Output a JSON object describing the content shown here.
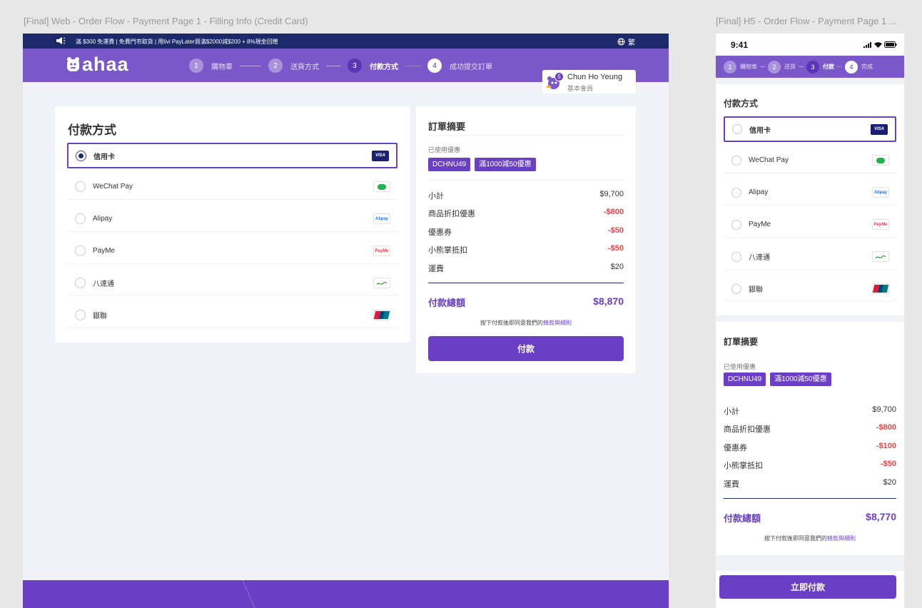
{
  "frames": {
    "web_title": "[Final] Web - Order Flow - Payment Page 1 - Filling Info (Credit Card)",
    "h5_title": "[Final] H5 - Order Flow - Payment Page 1 ..."
  },
  "web": {
    "promo_text": "滿 $300 免運費 | 免費門市取貨 | 用livi PayLater買滿$2000減$200 + 8%現金回贈",
    "language": "繁",
    "logo_text": "ahaa",
    "steps": [
      {
        "num": "1",
        "label": "購物車"
      },
      {
        "num": "2",
        "label": "送貨方式"
      },
      {
        "num": "3",
        "label": "付款方式"
      },
      {
        "num": "4",
        "label": "成功提交訂單"
      }
    ],
    "user": {
      "badge": "5",
      "name": "Chun Ho Yeung",
      "tier": "基本會員"
    },
    "payment": {
      "title": "付款方式",
      "options": [
        {
          "label": "信用卡",
          "icon": "visa-icon",
          "icon_text": "VISA",
          "selected": true
        },
        {
          "label": "WeChat Pay",
          "icon": "wechat-pay-icon",
          "selected": false
        },
        {
          "label": "Alipay",
          "icon": "alipay-icon",
          "icon_text": "Alipay",
          "selected": false
        },
        {
          "label": "PayMe",
          "icon": "payme-icon",
          "icon_text": "PayMe",
          "selected": false
        },
        {
          "label": "八達通",
          "icon": "octopus-icon",
          "selected": false
        },
        {
          "label": "銀聯",
          "icon": "unionpay-icon",
          "selected": false
        }
      ]
    },
    "summary": {
      "title": "訂單摘要",
      "used_label": "已使用優惠",
      "coupons": [
        "DCHNU49",
        "滿1000減50優惠"
      ],
      "rows": [
        {
          "label": "小計",
          "value": "$9,700",
          "negative": false
        },
        {
          "label": "商品折扣優惠",
          "value": "-$800",
          "negative": true
        },
        {
          "label": "優惠券",
          "value": "-$50",
          "negative": true
        },
        {
          "label": "小熊掌抵扣",
          "value": "-$50",
          "negative": true
        },
        {
          "label": "運費",
          "value": "$20",
          "negative": false
        }
      ],
      "total_label": "付款總額",
      "total_value": "$8,870",
      "terms_prefix": "按下付款後即同意我們的",
      "terms_link": "條款與細則",
      "pay_button": "付款"
    }
  },
  "h5": {
    "time": "9:41",
    "steps": [
      {
        "num": "1",
        "label": "購物車"
      },
      {
        "num": "2",
        "label": "送貨"
      },
      {
        "num": "3",
        "label": "付款"
      },
      {
        "num": "4",
        "label": "完成"
      }
    ],
    "payment": {
      "title": "付款方式",
      "options": [
        {
          "label": "信用卡",
          "icon": "visa-icon",
          "icon_text": "VISA",
          "selected": true
        },
        {
          "label": "WeChat Pay",
          "icon": "wechat-pay-icon",
          "selected": false
        },
        {
          "label": "Alipay",
          "icon": "alipay-icon",
          "icon_text": "Alipay",
          "selected": false
        },
        {
          "label": "PayMe",
          "icon": "payme-icon",
          "icon_text": "PayMe",
          "selected": false
        },
        {
          "label": "八達通",
          "icon": "octopus-icon",
          "selected": false
        },
        {
          "label": "銀聯",
          "icon": "unionpay-icon",
          "selected": false
        }
      ]
    },
    "summary": {
      "title": "訂單摘要",
      "used_label": "已使用優惠",
      "coupons": [
        "DCHNU49",
        "滿1000減50優惠"
      ],
      "rows": [
        {
          "label": "小計",
          "value": "$9,700",
          "negative": false
        },
        {
          "label": "商品折扣優惠",
          "value": "-$800",
          "negative": true
        },
        {
          "label": "優惠券",
          "value": "-$100",
          "negative": true
        },
        {
          "label": "小熊掌抵扣",
          "value": "-$50",
          "negative": true
        },
        {
          "label": "運費",
          "value": "$20",
          "negative": false
        }
      ],
      "total_label": "付款總額",
      "total_value": "$8,770",
      "terms_prefix": "按下付款後即同意我們的",
      "terms_link": "條款與細則",
      "pay_button": "立即付款"
    }
  },
  "colors": {
    "brand_purple": "#6a3fc6",
    "header_purple": "#7b58c9",
    "promo_navy": "#1c2a6b",
    "negative_red": "#e64545"
  }
}
